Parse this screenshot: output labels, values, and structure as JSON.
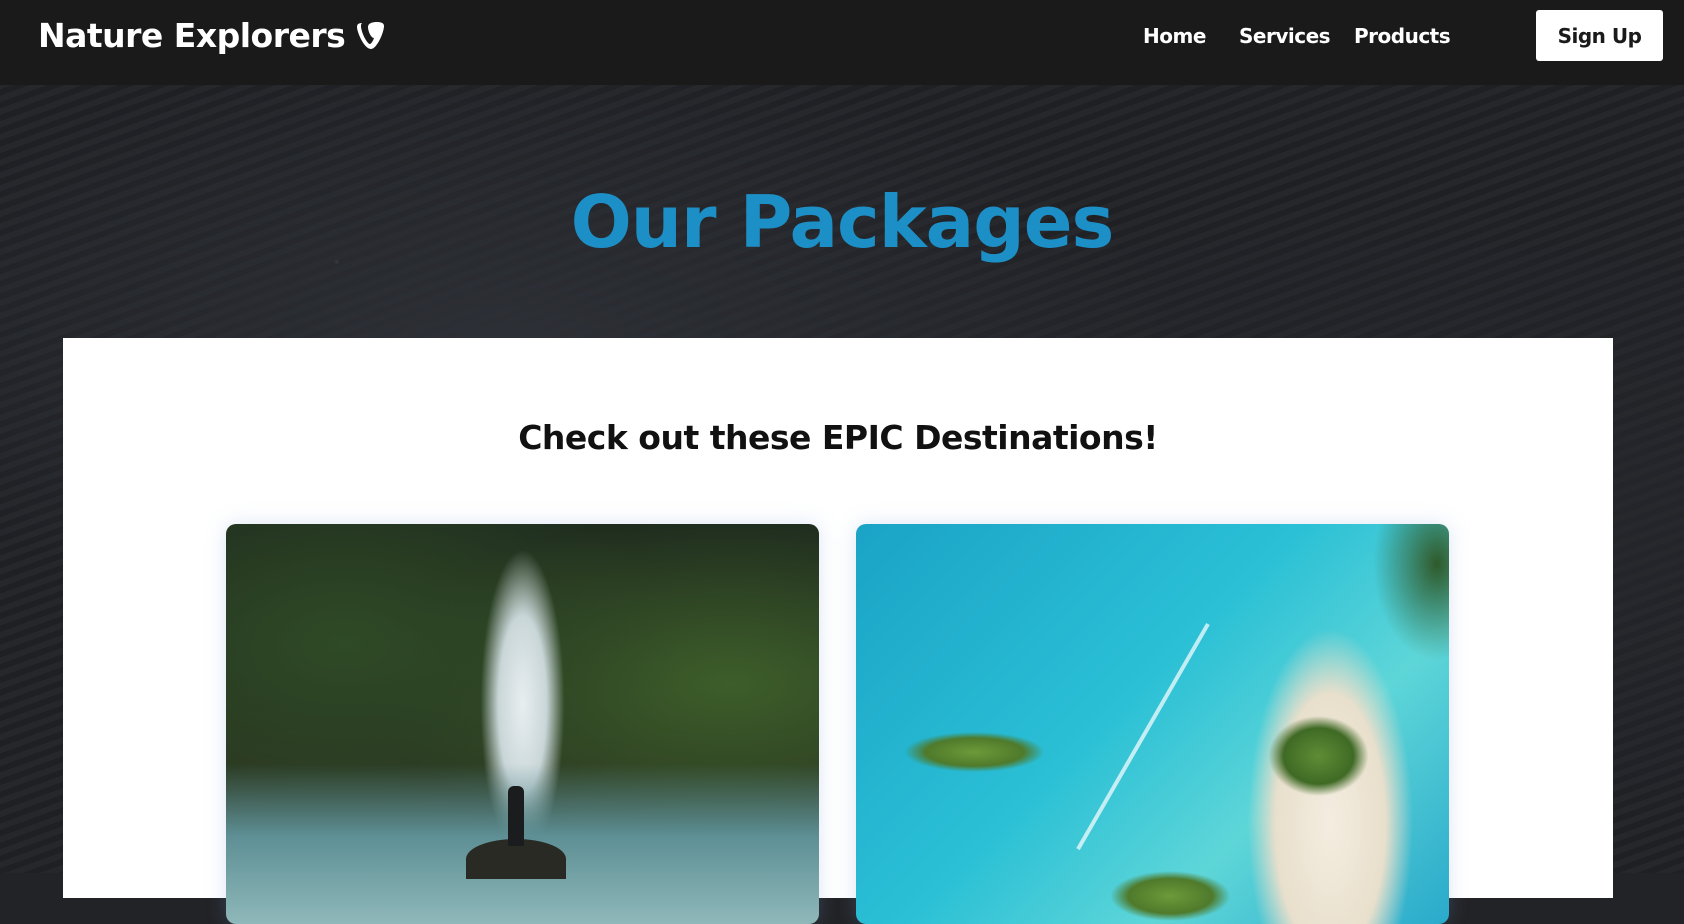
{
  "header": {
    "brand": "Nature Explorers",
    "nav": [
      "Home",
      "Services",
      "Products"
    ],
    "signup_label": "Sign Up"
  },
  "hero": {
    "title": "Our Packages"
  },
  "section": {
    "heading": "Check out these EPIC Destinations!"
  },
  "colors": {
    "accent": "#1d8fc7",
    "header_bg": "#1b1a1a"
  }
}
